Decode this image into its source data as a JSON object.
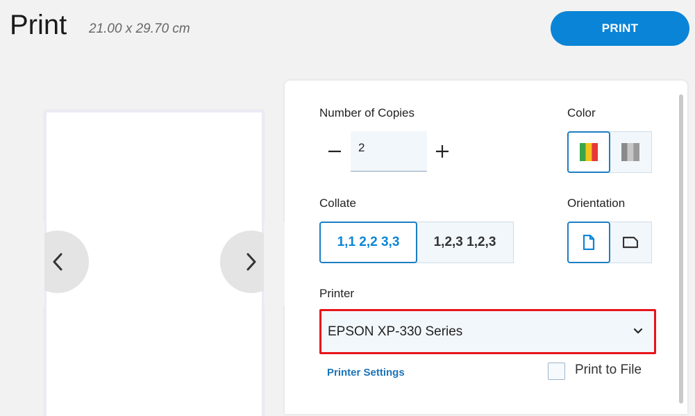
{
  "header": {
    "title": "Print",
    "dimensions": "21.00 x 29.70 cm",
    "print_label": "PRINT"
  },
  "preview": {
    "prev_icon": "chevron-left-icon",
    "next_icon": "chevron-right-icon"
  },
  "settings": {
    "copies": {
      "label": "Number of Copies",
      "value": "2",
      "minus_icon": "minus-icon",
      "plus_icon": "plus-icon"
    },
    "color": {
      "label": "Color",
      "options": [
        {
          "icon": "color-bars-icon",
          "selected": true
        },
        {
          "icon": "grayscale-bars-icon",
          "selected": false
        }
      ]
    },
    "collate": {
      "label": "Collate",
      "options": [
        {
          "label": "1,1 2,2 3,3",
          "selected": true
        },
        {
          "label": "1,2,3 1,2,3",
          "selected": false
        }
      ]
    },
    "orientation": {
      "label": "Orientation",
      "options": [
        {
          "icon": "portrait-page-icon",
          "selected": true
        },
        {
          "icon": "landscape-page-icon",
          "selected": false
        }
      ]
    },
    "printer": {
      "label": "Printer",
      "value": "EPSON XP-330 Series",
      "dropdown_icon": "chevron-down-icon",
      "settings_link": "Printer Settings"
    },
    "print_to_file": {
      "label": "Print to File",
      "checked": false
    }
  },
  "colors": {
    "accent": "#0a84d6",
    "highlight_border": "#e8131b",
    "bar_red": "#e53935",
    "bar_yellow": "#f6c21c",
    "bar_green": "#3aa64a"
  }
}
